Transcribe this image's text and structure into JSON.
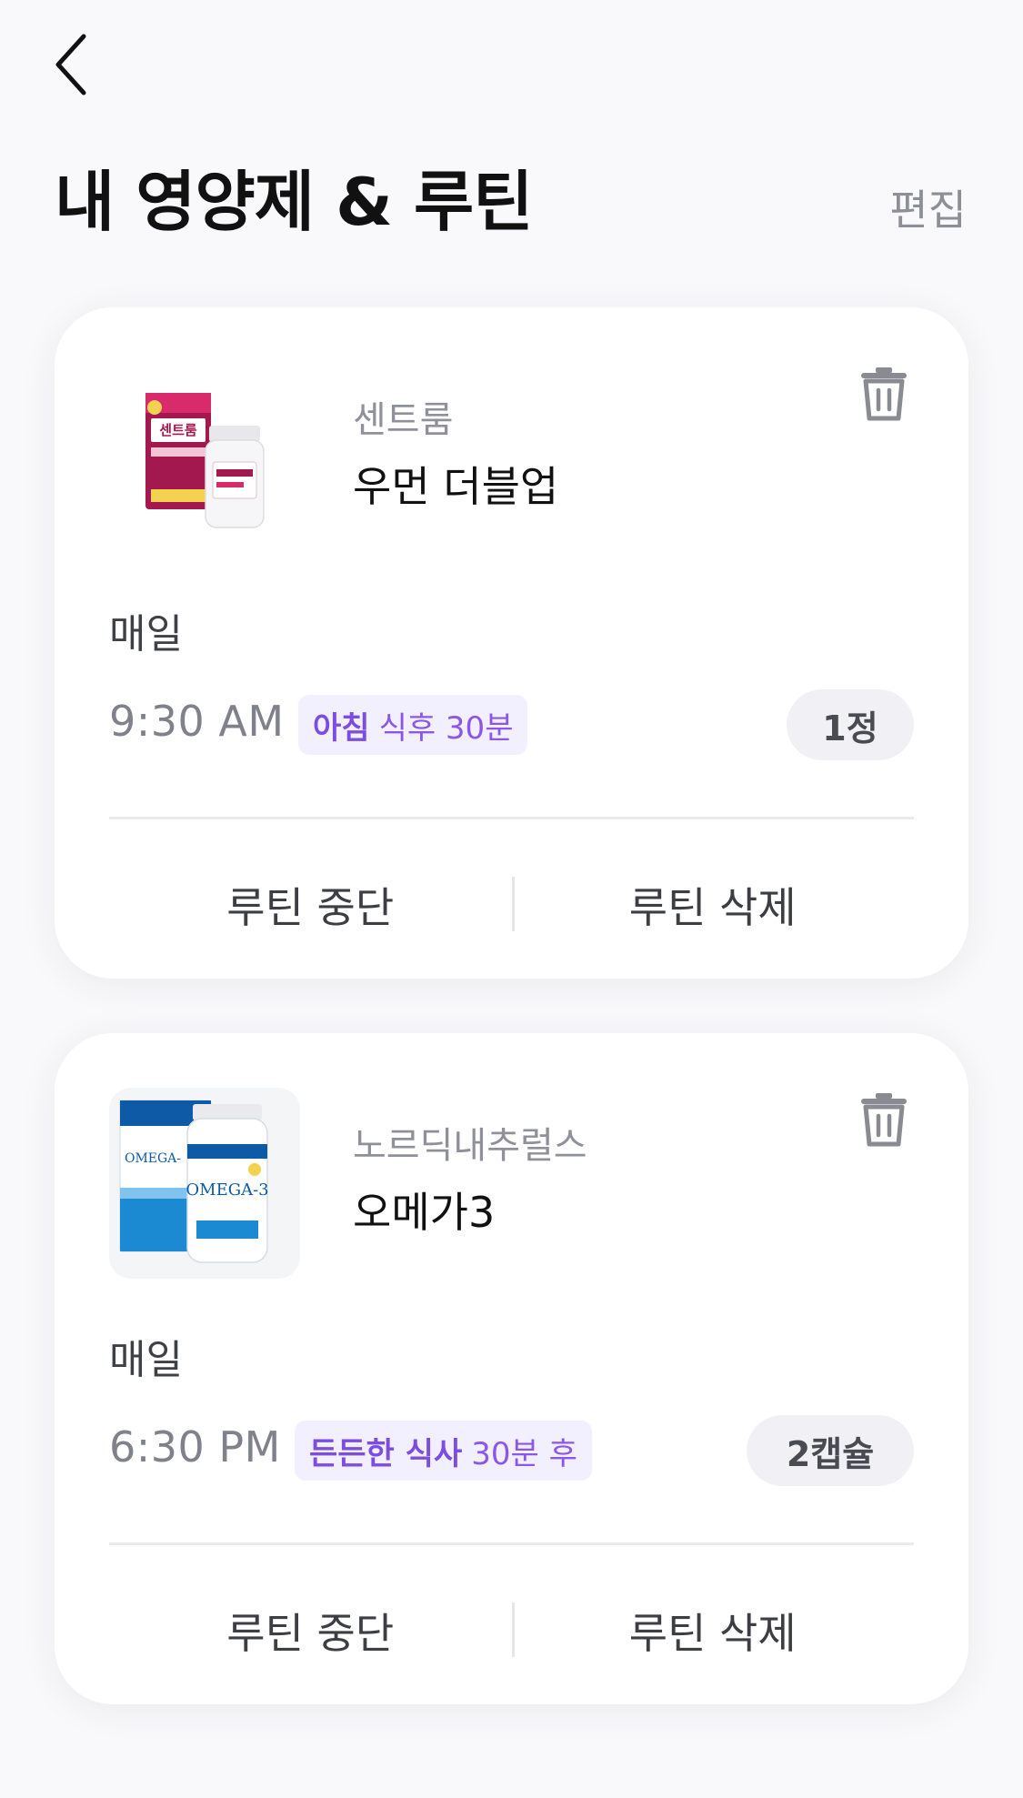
{
  "header": {
    "back_icon": "chevron-left-icon",
    "title": "내 영양제 & 루틴",
    "edit_label": "편집"
  },
  "routines": [
    {
      "brand": "센트룸",
      "product": "우먼 더블업",
      "frequency": "매일",
      "time": "9:30 AM",
      "timing_strong": "아침",
      "timing_rest": "식후 30분",
      "dose": "1정",
      "stop_label": "루틴 중단",
      "delete_label": "루틴 삭제",
      "trash_icon": "trash-icon",
      "image_label": "센트룸"
    },
    {
      "brand": "노르딕내추럴스",
      "product": "오메가3",
      "frequency": "매일",
      "time": "6:30 PM",
      "timing_strong": "든든한 식사",
      "timing_rest": "30분 후",
      "dose": "2캡슐",
      "stop_label": "루틴 중단",
      "delete_label": "루틴 삭제",
      "trash_icon": "trash-icon",
      "image_label": "OMEGA-3"
    }
  ],
  "colors": {
    "accent_purple": "#8a57e8",
    "tag_bg": "#f2f0fe",
    "muted_text": "#80828b"
  }
}
